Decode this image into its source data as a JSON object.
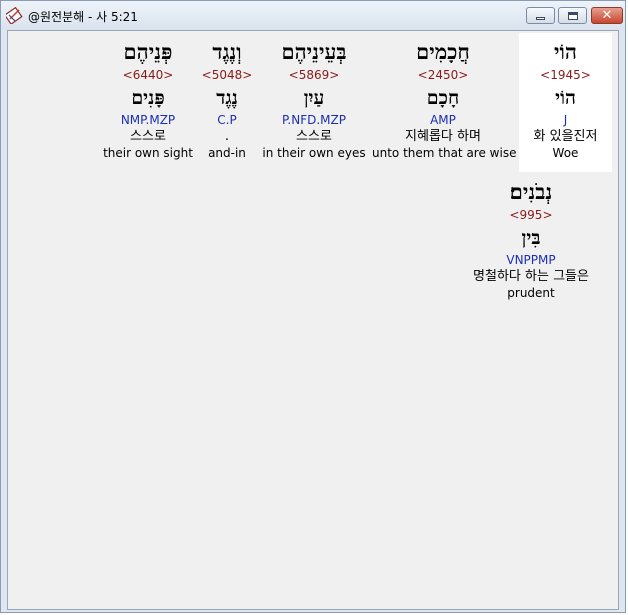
{
  "window": {
    "title": "@원전분해 - 사 5:21"
  },
  "words": [
    {
      "hebrew": "הוֹי",
      "strong": "<1945>",
      "root": "הוֹי",
      "morph": "J",
      "korean": "화 있을진저",
      "english": "Woe"
    },
    {
      "hebrew": "חֲכָמִים",
      "strong": "<2450>",
      "root": "חָכָם",
      "morph": "AMP",
      "korean": "지혜롭다 하며",
      "english": "unto them that are wise"
    },
    {
      "hebrew": "בְּעֵינֵיהֶם",
      "strong": "<5869>",
      "root": "עַיִן",
      "morph": "P.NFD.MZP",
      "korean": "스스로",
      "english": "in their own eyes"
    },
    {
      "hebrew": "וְנֶגֶד",
      "strong": "<5048>",
      "root": "נֶגֶד",
      "morph": "C.P",
      "korean": ".",
      "english": "and-in"
    },
    {
      "hebrew": "פְּנֵיהֶם",
      "strong": "<6440>",
      "root": "פָּנִים",
      "morph": "NMP.MZP",
      "korean": "스스로",
      "english": "their own sight"
    },
    {
      "hebrew": "נְבֹנִים׃",
      "strong": "<995>",
      "root": "בִּין",
      "morph": "VNPPMP",
      "korean": "명철하다 하는 그들은",
      "english": "prudent"
    }
  ]
}
